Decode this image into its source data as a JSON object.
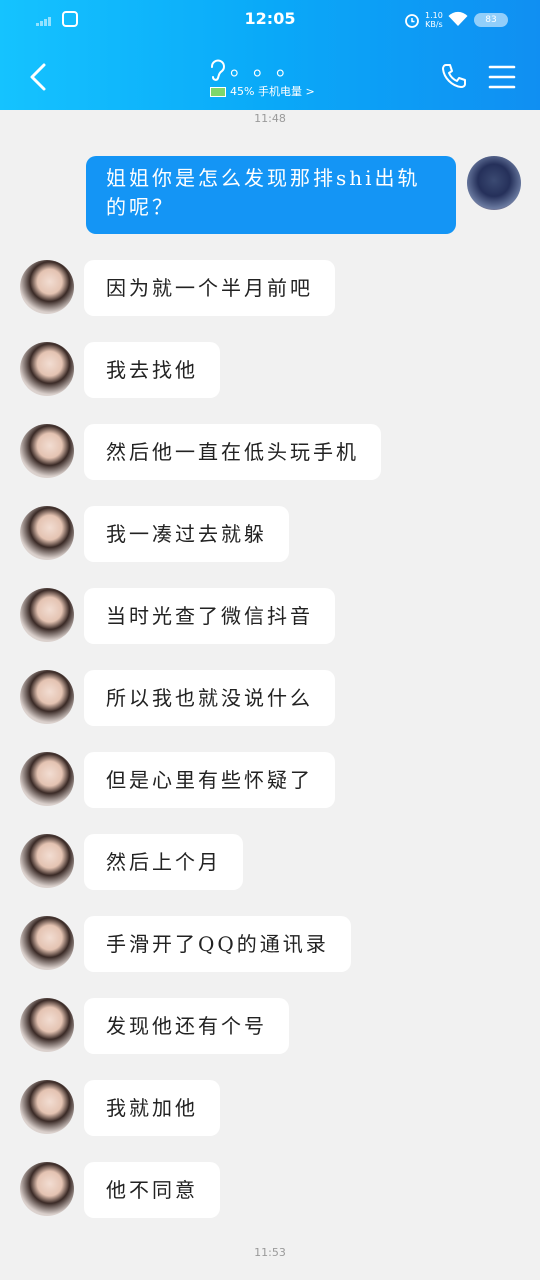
{
  "status_bar": {
    "time": "12:05",
    "net_speed_value": "1.10",
    "net_speed_unit": "KB/s",
    "battery": "83"
  },
  "header": {
    "chat_name": "。。。",
    "sub_status": "45% 手机电量 >"
  },
  "messages": {
    "timestamp_top": "11:48",
    "timestamp_bottom": "11:53",
    "outgoing": "姐姐你是怎么发现那排shi出轨的呢？",
    "incoming": [
      "因为就一个半月前吧",
      "我去找他",
      "然后他一直在低头玩手机",
      "我一凑过去就躲",
      "当时光查了微信抖音",
      "所以我也就没说什么",
      "但是心里有些怀疑了",
      "然后上个月",
      "手滑开了QQ的通讯录",
      "发现他还有个号",
      "我就加他",
      "他不同意"
    ]
  },
  "icons": [
    "back-arrow-icon",
    "ear-icon",
    "phone-icon",
    "menu-icon",
    "alarm-icon",
    "wifi-icon",
    "signal-icon"
  ],
  "colors": {
    "header_start": "#15c3ff",
    "header_end": "#108ff2",
    "outgoing_bubble": "#1495f5",
    "background": "#f1f1f1"
  }
}
